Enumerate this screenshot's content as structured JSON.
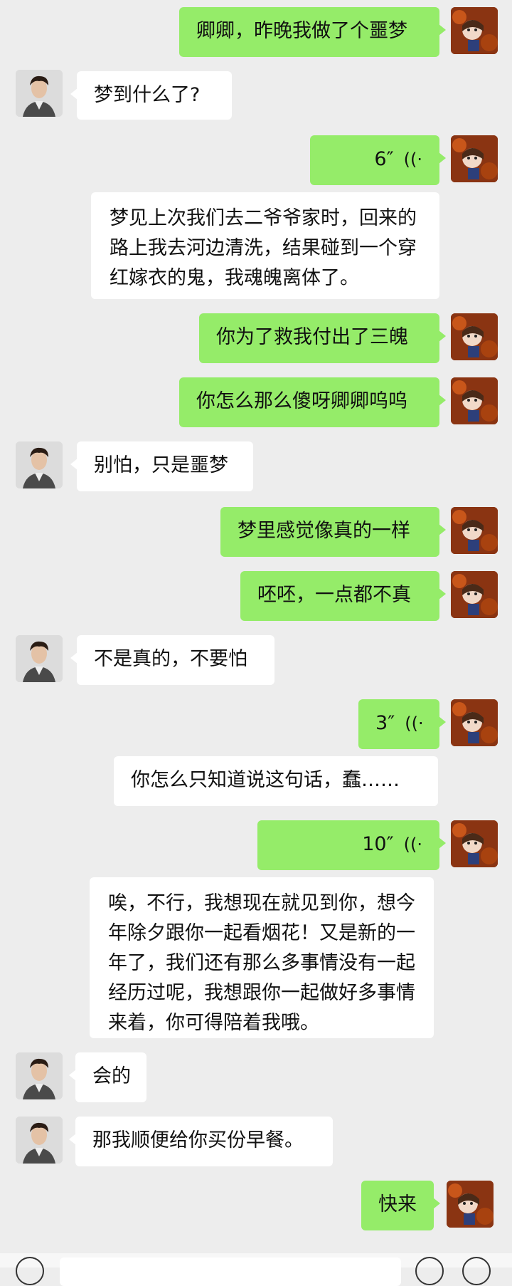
{
  "messages": [
    {
      "side": "right",
      "type": "text",
      "text": "卿卿，昨晚我做了个噩梦"
    },
    {
      "side": "left",
      "type": "text",
      "text": "梦到什么了?"
    },
    {
      "side": "right",
      "type": "voice",
      "duration": "6″"
    },
    {
      "side": "right-noavatar",
      "type": "text",
      "text": "梦见上次我们去二爷爷家时，回来的路上我去河边清洗，结果碰到一个穿红嫁衣的鬼，我魂魄离体了。"
    },
    {
      "side": "right",
      "type": "text",
      "text": "你为了救我付出了三魄"
    },
    {
      "side": "right",
      "type": "text",
      "text": "你怎么那么傻呀卿卿呜呜"
    },
    {
      "side": "left",
      "type": "text",
      "text": "别怕，只是噩梦"
    },
    {
      "side": "right",
      "type": "text",
      "text": "梦里感觉像真的一样"
    },
    {
      "side": "right",
      "type": "text",
      "text": "呸呸，一点都不真"
    },
    {
      "side": "left",
      "type": "text",
      "text": "不是真的，不要怕"
    },
    {
      "side": "right",
      "type": "voice",
      "duration": "3″"
    },
    {
      "side": "right-noavatar",
      "type": "text",
      "text": "你怎么只知道说这句话，蠢……"
    },
    {
      "side": "right",
      "type": "voice",
      "duration": "10″"
    },
    {
      "side": "right-noavatar",
      "type": "text",
      "text": "唉，不行，我想现在就见到你，想今年除夕跟你一起看烟花！又是新的一年了，我们还有那么多事情没有一起经历过呢，我想跟你一起做好多事情来着，你可得陪着我哦。"
    },
    {
      "side": "left",
      "type": "text",
      "text": "会的"
    },
    {
      "side": "left",
      "type": "text",
      "text": "那我顺便给你买份早餐。"
    },
    {
      "side": "right",
      "type": "text",
      "text": "快来"
    }
  ],
  "icons": {
    "voice_wave": "voice-wave-icon",
    "boy_avatar": "boy-avatar",
    "girl_avatar": "girl-avatar"
  },
  "colors": {
    "background": "#ededed",
    "sent_bubble": "#95ec69",
    "received_bubble": "#ffffff"
  }
}
